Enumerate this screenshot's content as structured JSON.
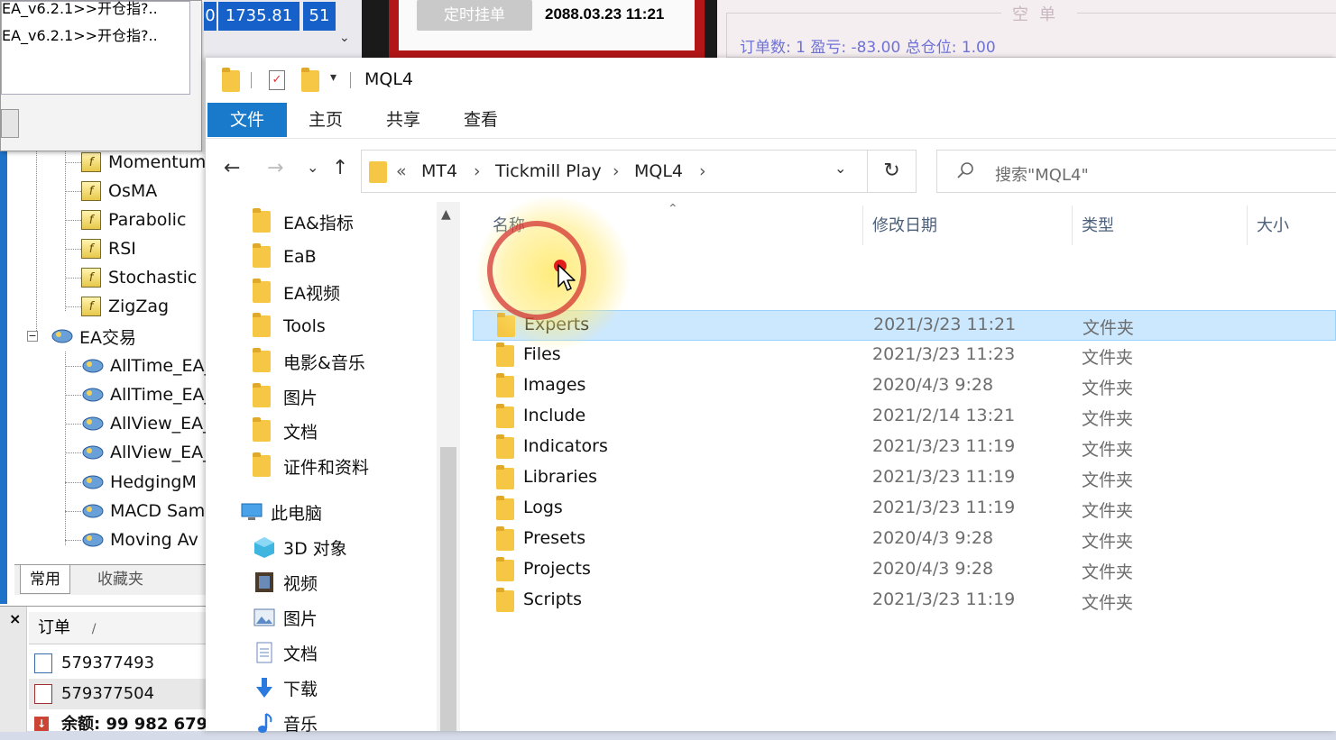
{
  "mt4": {
    "alert_lines": [
      "EA_v6.2.1>>开仓指?..",
      "EA_v6.2.1>>开仓指?.."
    ],
    "quote_price": "1735.81",
    "quote_spread": "51",
    "quote_prefix": "0",
    "pending_button": "定时挂单",
    "order_time": "2088.03.23 11:21",
    "summary_title": "空单",
    "summary_text": "订单数: 1  盈亏: -83.00  总仓位: 1.00",
    "indicators": [
      "Momentum",
      "OsMA",
      "Parabolic",
      "RSI",
      "Stochastic",
      "ZigZag"
    ],
    "ea_group": "EA交易",
    "eas": [
      "AllTime_EA_",
      "AllTime_EA_",
      "AllView_EA_",
      "AllView_EA_",
      "HedgingM",
      "MACD Sam",
      "Moving Av"
    ],
    "tabs": [
      "常用",
      "收藏夹"
    ],
    "terminal": {
      "close": "×",
      "header": "订单",
      "sort_mark": "/",
      "rows": [
        "579377493",
        "579377504"
      ],
      "balance": "余额: 99 982 679."
    }
  },
  "explorer": {
    "window_title": "MQL4",
    "ribbon_tabs": [
      "文件",
      "主页",
      "共享",
      "查看"
    ],
    "nav": {
      "back": "←",
      "forward": "→",
      "recent": "⌄",
      "up": "↑"
    },
    "address": {
      "overflow": "«",
      "crumbs": [
        "MT4",
        "Tickmill Play",
        "MQL4"
      ],
      "separator": "›",
      "dropdown": "⌄"
    },
    "refresh": "↻",
    "search_placeholder": "搜索\"MQL4\"",
    "nav_pane": {
      "folders": [
        "EA&指标",
        "EaB",
        "EA视频",
        "Tools",
        "电影&音乐",
        "图片",
        "文档",
        "证件和资料"
      ],
      "this_pc": "此电脑",
      "pc_items": [
        "3D 对象",
        "视频",
        "图片",
        "文档",
        "下载",
        "音乐"
      ]
    },
    "columns": {
      "name": "名称",
      "date": "修改日期",
      "type": "类型",
      "size": "大小"
    },
    "files": [
      {
        "name": "Experts",
        "date": "2021/3/23 11:21",
        "type": "文件夹",
        "selected": true
      },
      {
        "name": "Files",
        "date": "2021/3/23 11:23",
        "type": "文件夹"
      },
      {
        "name": "Images",
        "date": "2020/4/3 9:28",
        "type": "文件夹"
      },
      {
        "name": "Include",
        "date": "2021/2/14 13:21",
        "type": "文件夹"
      },
      {
        "name": "Indicators",
        "date": "2021/3/23 11:19",
        "type": "文件夹"
      },
      {
        "name": "Libraries",
        "date": "2021/3/23 11:19",
        "type": "文件夹"
      },
      {
        "name": "Logs",
        "date": "2021/3/23 11:19",
        "type": "文件夹"
      },
      {
        "name": "Presets",
        "date": "2020/4/3 9:28",
        "type": "文件夹"
      },
      {
        "name": "Projects",
        "date": "2020/4/3 9:28",
        "type": "文件夹"
      },
      {
        "name": "Scripts",
        "date": "2021/3/23 11:19",
        "type": "文件夹"
      }
    ]
  },
  "colors": {
    "ribbon_active": "#1979ca",
    "selection": "#cce8ff",
    "folder": "#f6c744",
    "mt4_blue": "#1560c9",
    "mt4_red": "#b21616"
  }
}
